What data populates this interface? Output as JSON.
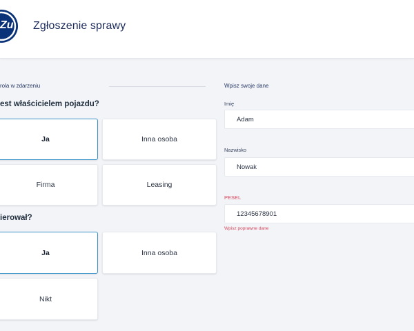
{
  "header": {
    "title": "Zgłoszenie sprawy",
    "logo_text": "Zu"
  },
  "left": {
    "role_label": "rola w zdarzeniu",
    "owner_question": "est właścicielem pojazdu?",
    "owner_options": [
      {
        "label": "Ja",
        "selected": true
      },
      {
        "label": "Inna osoba",
        "selected": false
      },
      {
        "label": "Firma",
        "selected": false
      },
      {
        "label": "Leasing",
        "selected": false
      }
    ],
    "driver_question": "ierował?",
    "driver_options": [
      {
        "label": "Ja",
        "selected": true
      },
      {
        "label": "Inna osoba",
        "selected": false
      },
      {
        "label": "Nikt",
        "selected": false
      }
    ]
  },
  "right": {
    "section_label": "Wpisz swoje dane",
    "fields": {
      "first_name": {
        "label": "Imię",
        "value": "Adam"
      },
      "last_name": {
        "label": "Nazwisko",
        "value": "Nowak"
      },
      "pesel": {
        "label": "PESEL",
        "value": "12345678901",
        "error": "Wpisz poprawne dane"
      }
    }
  },
  "colors": {
    "brand_navy": "#0a3278",
    "selected_border": "#3a93c9",
    "error": "#d9475e",
    "background": "#f2f4f7"
  }
}
